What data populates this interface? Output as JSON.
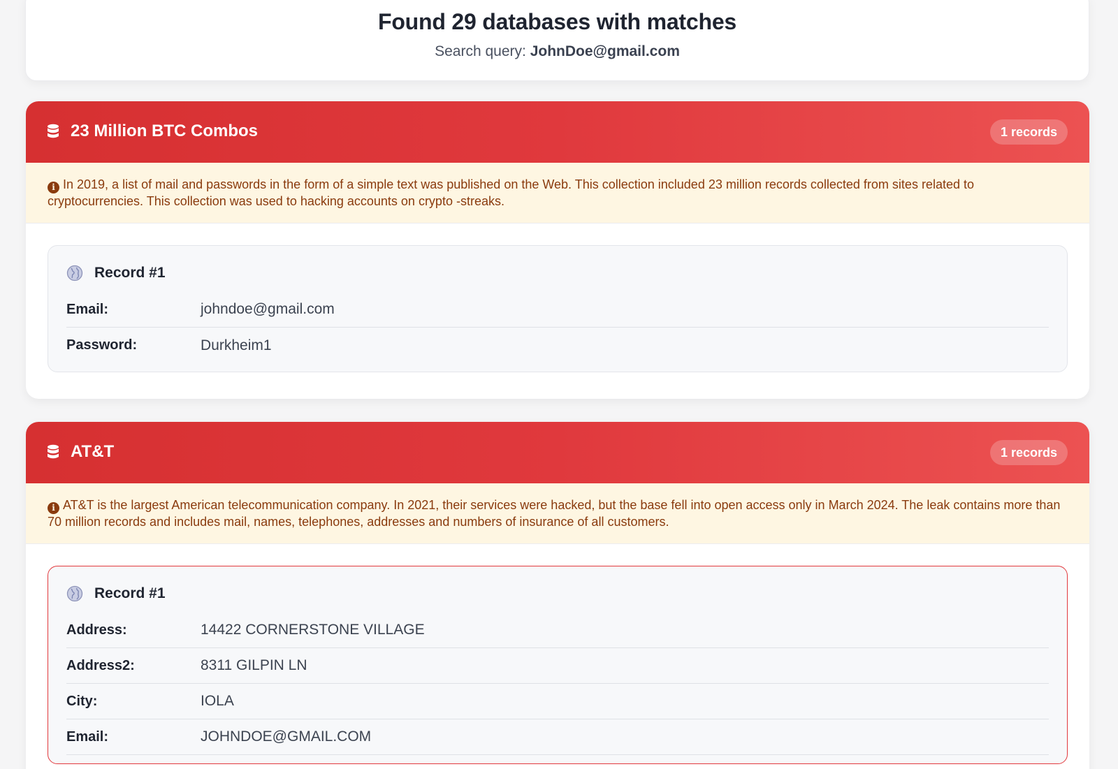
{
  "summary": {
    "title": "Found 29 databases with matches",
    "query_label": "Search query: ",
    "query_value": "JohnDoe@gmail.com"
  },
  "databases": [
    {
      "name": "23 Million BTC Combos",
      "count_label": "1 records",
      "description": "In 2019, a list of mail and passwords in the form of a simple text was published on the Web. This collection included 23 million records collected from sites related to cryptocurrencies. This collection was used to hacking accounts on crypto -streaks.",
      "records": [
        {
          "title": "Record #1",
          "fields": [
            {
              "label": "Email:",
              "value": "johndoe@gmail.com"
            },
            {
              "label": "Password:",
              "value": "Durkheim1"
            }
          ]
        }
      ]
    },
    {
      "name": "AT&T",
      "count_label": "1 records",
      "description": "AT&T is the largest American telecommunication company. In 2021, their services were hacked, but the base fell into open access only in March 2024. The leak contains more than 70 million records and includes mail, names, telephones, addresses and numbers of insurance of all customers.",
      "records": [
        {
          "title": "Record #1",
          "fields": [
            {
              "label": "Address:",
              "value": "14422 CORNERSTONE VILLAGE"
            },
            {
              "label": "Address2:",
              "value": "8311 GILPIN LN"
            },
            {
              "label": "City:",
              "value": "IOLA"
            },
            {
              "label": "Email:",
              "value": "JOHNDOE@GMAIL.COM"
            }
          ]
        }
      ]
    }
  ],
  "colors": {
    "header_red": "#d63031",
    "header_red_light": "#ec5252",
    "description_bg": "#fef6e2",
    "description_text": "#8a3b0e",
    "record_highlight_border": "#e2393d"
  },
  "icons": {
    "database": "database-icon",
    "info": "info-icon",
    "record": "globe-icon"
  }
}
